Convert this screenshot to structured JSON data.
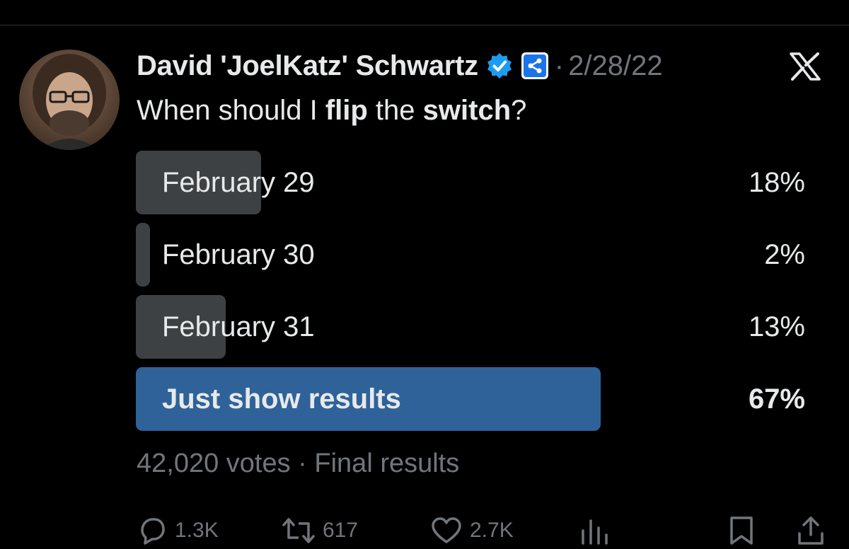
{
  "tweet": {
    "author_name": "David 'JoelKatz' Schwartz",
    "separator": "·",
    "date": "2/28/22",
    "text_parts": [
      "When should I ",
      "flip",
      " the ",
      "switch",
      "?"
    ]
  },
  "poll": {
    "options": [
      {
        "label": "February 29",
        "percent_text": "18%",
        "percent": 18
      },
      {
        "label": "February 30",
        "percent_text": "2%",
        "percent": 2
      },
      {
        "label": "February 31",
        "percent_text": "13%",
        "percent": 13
      },
      {
        "label": "Just show results",
        "percent_text": "67%",
        "percent": 67
      }
    ],
    "votes": "42,020 votes",
    "meta_separator": "·",
    "status": "Final results"
  },
  "actions": {
    "replies": "1.3K",
    "reposts": "617",
    "likes": "2.7K"
  },
  "colors": {
    "background": "#000000",
    "bar": "#3e4144",
    "winner_bar": "#2f6299",
    "verified": "#1d9bf0",
    "muted_text": "#71767b"
  },
  "icons": [
    "verified-badge-icon",
    "xrp-affiliate-icon",
    "x-logo-icon",
    "reply-icon",
    "repost-icon",
    "like-icon",
    "views-icon",
    "bookmark-icon",
    "share-icon"
  ]
}
